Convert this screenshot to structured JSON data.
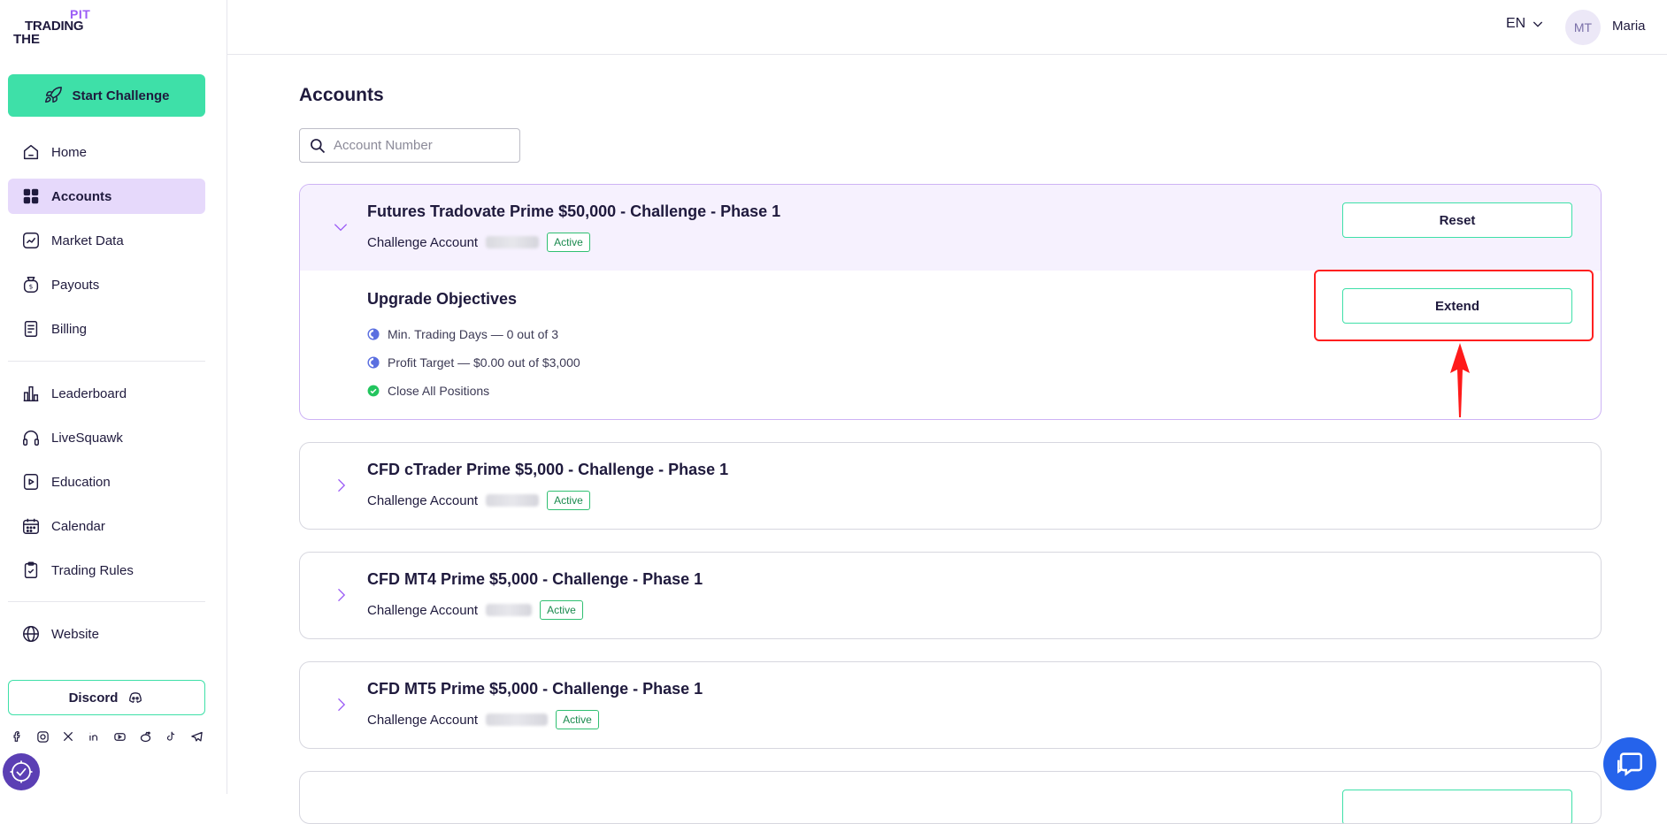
{
  "brand": {
    "pit": "PIT",
    "trading": "TRADING",
    "the": "THE"
  },
  "sidebar": {
    "start_label": "Start Challenge",
    "items": [
      {
        "label": "Home",
        "icon": "home-icon"
      },
      {
        "label": "Accounts",
        "icon": "grid-icon",
        "active": true
      },
      {
        "label": "Market Data",
        "icon": "chart-icon"
      },
      {
        "label": "Payouts",
        "icon": "wallet-icon"
      },
      {
        "label": "Billing",
        "icon": "receipt-icon"
      },
      {
        "label": "Leaderboard",
        "icon": "bar-chart-icon"
      },
      {
        "label": "LiveSquawk",
        "icon": "headphones-icon"
      },
      {
        "label": "Education",
        "icon": "play-book-icon"
      },
      {
        "label": "Calendar",
        "icon": "calendar-icon"
      },
      {
        "label": "Trading Rules",
        "icon": "clipboard-icon"
      },
      {
        "label": "Website",
        "icon": "globe-icon"
      }
    ],
    "discord_label": "Discord",
    "socials": [
      "facebook-icon",
      "instagram-icon",
      "x-icon",
      "linkedin-icon",
      "youtube-icon",
      "reddit-icon",
      "tiktok-icon",
      "telegram-icon"
    ]
  },
  "header": {
    "lang": "EN",
    "avatar_initials": "MT",
    "username": "Maria"
  },
  "main": {
    "title": "Accounts",
    "search_placeholder": "Account Number",
    "accounts": [
      {
        "title": "Futures Tradovate Prime $50,000 - Challenge - Phase 1",
        "sub": "Challenge Account",
        "status": "Active",
        "reset_label": "Reset",
        "extend_label": "Extend",
        "objectives_title": "Upgrade Objectives",
        "objectives": [
          "Min. Trading Days — 0 out of 3",
          "Profit Target — $0.00 out of $3,000",
          "Close All Positions"
        ]
      },
      {
        "title": "CFD cTrader Prime $5,000 - Challenge - Phase 1",
        "sub": "Challenge Account",
        "status": "Active"
      },
      {
        "title": "CFD MT4 Prime $5,000 - Challenge - Phase 1",
        "sub": "Challenge Account",
        "status": "Active"
      },
      {
        "title": "CFD MT5 Prime $5,000 - Challenge - Phase 1",
        "sub": "Challenge Account",
        "status": "Active"
      }
    ]
  },
  "colors": {
    "accent": "#3ee0a8",
    "active_nav": "#e6d9fb",
    "brand_purple": "#9b5cf6",
    "highlight": "#ff2020"
  }
}
